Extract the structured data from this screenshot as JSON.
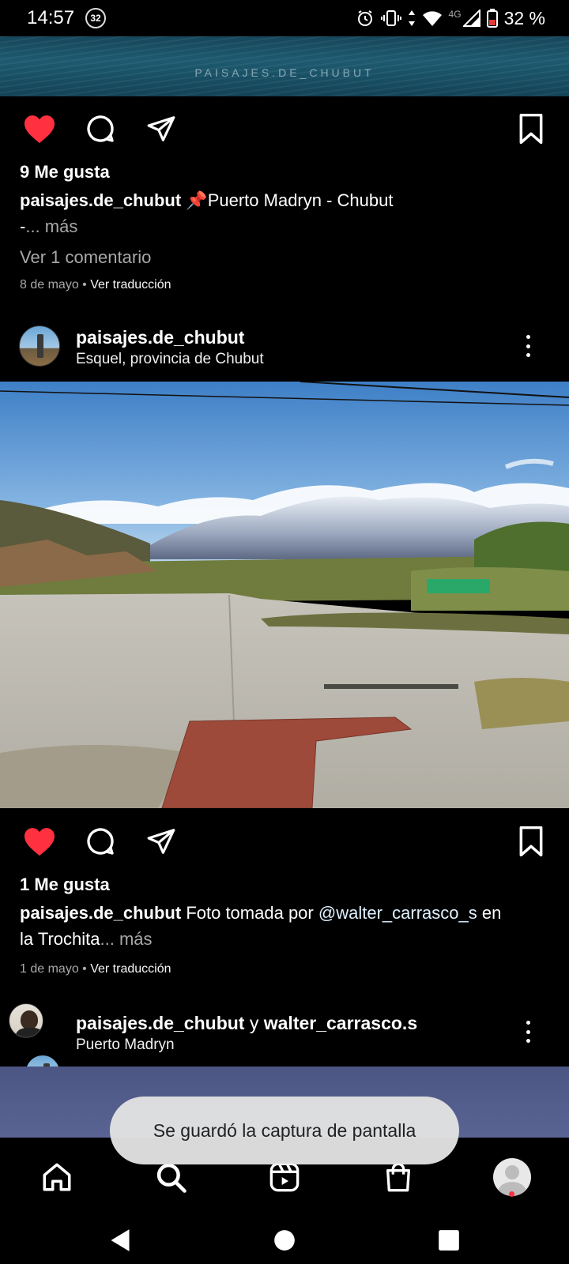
{
  "status_bar": {
    "time": "14:57",
    "notification_count": "32",
    "network_type": "4G",
    "battery_percent": "32 %"
  },
  "post_prev": {
    "watermark": "PAISAJES.DE_CHUBUT",
    "likes": "9 Me gusta",
    "caption_user": "paisajes.de_chubut",
    "caption_text": "📌Puerto Madryn - Chubut",
    "caption_cont": "-",
    "more_label": "... más",
    "view_comments": "Ver 1 comentario",
    "date": "8 de mayo",
    "translate": "Ver traducción"
  },
  "post_main": {
    "username": "paisajes.de_chubut",
    "location": "Esquel, provincia de Chubut",
    "likes": "1 Me gusta",
    "caption_user": "paisajes.de_chubut",
    "caption_text": "Foto tomada por",
    "mention": "@walter_carrasco_s",
    "caption_text2": " en",
    "caption_line2": "la Trochita",
    "more_label": "... más",
    "date": "1 de mayo",
    "translate": "Ver traducción"
  },
  "post_next": {
    "username_1": "paisajes.de_chubut",
    "connector": " y ",
    "username_2": "walter_carrasco.s",
    "location": "Puerto Madryn"
  },
  "toast": {
    "message": "Se guardó la captura de pantalla"
  },
  "bottom_nav": {
    "items": [
      "home",
      "search",
      "reels",
      "shop",
      "profile"
    ]
  },
  "colors": {
    "like_red": "#ff3040",
    "background": "#000000",
    "muted_text": "#a8a8a8"
  }
}
